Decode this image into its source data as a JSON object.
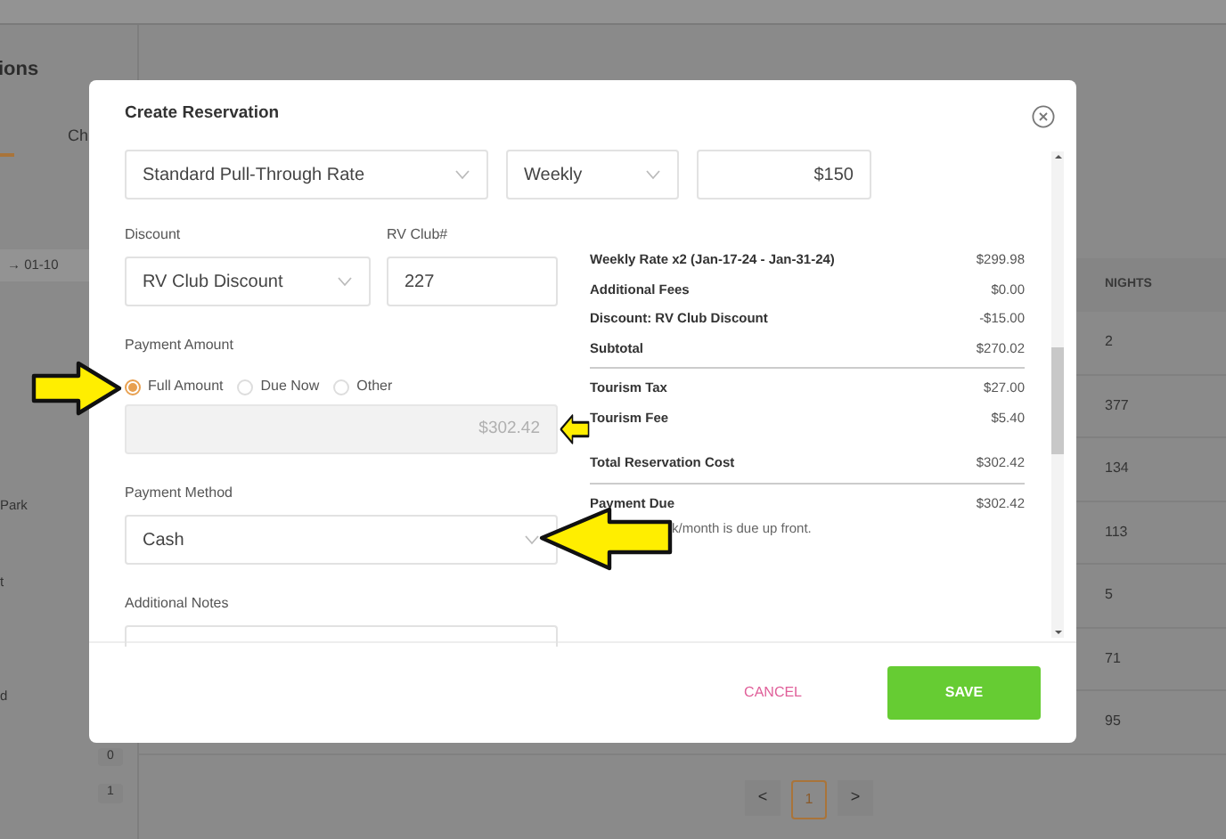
{
  "background": {
    "page_title": "ions",
    "tab": "Ch",
    "date_field": "→ 01-10",
    "sidebar_items": [
      "Park",
      "t",
      "d"
    ],
    "counts": [
      "0",
      "1"
    ],
    "nights_header": "NIGHTS",
    "nights": [
      "2",
      "377",
      "134",
      "113",
      "5",
      "71",
      "95"
    ],
    "pagination": {
      "prev": "<",
      "page": "1",
      "next": ">"
    }
  },
  "modal": {
    "title": "Create Reservation",
    "rate_select": "Standard Pull-Through Rate",
    "frequency_select": "Weekly",
    "rate_amount": "$150",
    "discount_label": "Discount",
    "discount": "RV Club Discount",
    "rv_club_label": "RV Club#",
    "rv_club": "227",
    "payment_amount_label": "Payment Amount",
    "payment_options": [
      {
        "label": "Full Amount",
        "selected": true
      },
      {
        "label": "Due Now",
        "selected": false
      },
      {
        "label": "Other",
        "selected": false
      }
    ],
    "amount_value": "$302.42",
    "payment_method_label": "Payment Method",
    "payment_method": "Cash",
    "notes_label": "Additional Notes",
    "summary": [
      {
        "rule_after": true,
        "rows": [
          {
            "label": "Weekly Rate x2 (Jan-17-24 - Jan-31-24)",
            "amount": "$299.98"
          },
          {
            "label": "Additional Fees",
            "amount": "$0.00"
          },
          {
            "label": "Discount: RV Club Discount",
            "amount": "-$15.00"
          },
          {
            "label": "Subtotal",
            "amount": "$270.02"
          }
        ]
      },
      {
        "rule_after": false,
        "rows": [
          {
            "label": "Tourism Tax",
            "amount": "$27.00"
          },
          {
            "label": "Tourism Fee",
            "amount": "$5.40"
          }
        ]
      },
      {
        "rule_after": true,
        "rows": [
          {
            "label": "Total Reservation Cost",
            "amount": "$302.42"
          }
        ]
      },
      {
        "rule_after": false,
        "rows": [
          {
            "label": "Payment Due",
            "amount": "$302.42"
          }
        ]
      }
    ],
    "note": "k/month is due up front.",
    "cancel": "CANCEL",
    "save": "SAVE"
  }
}
